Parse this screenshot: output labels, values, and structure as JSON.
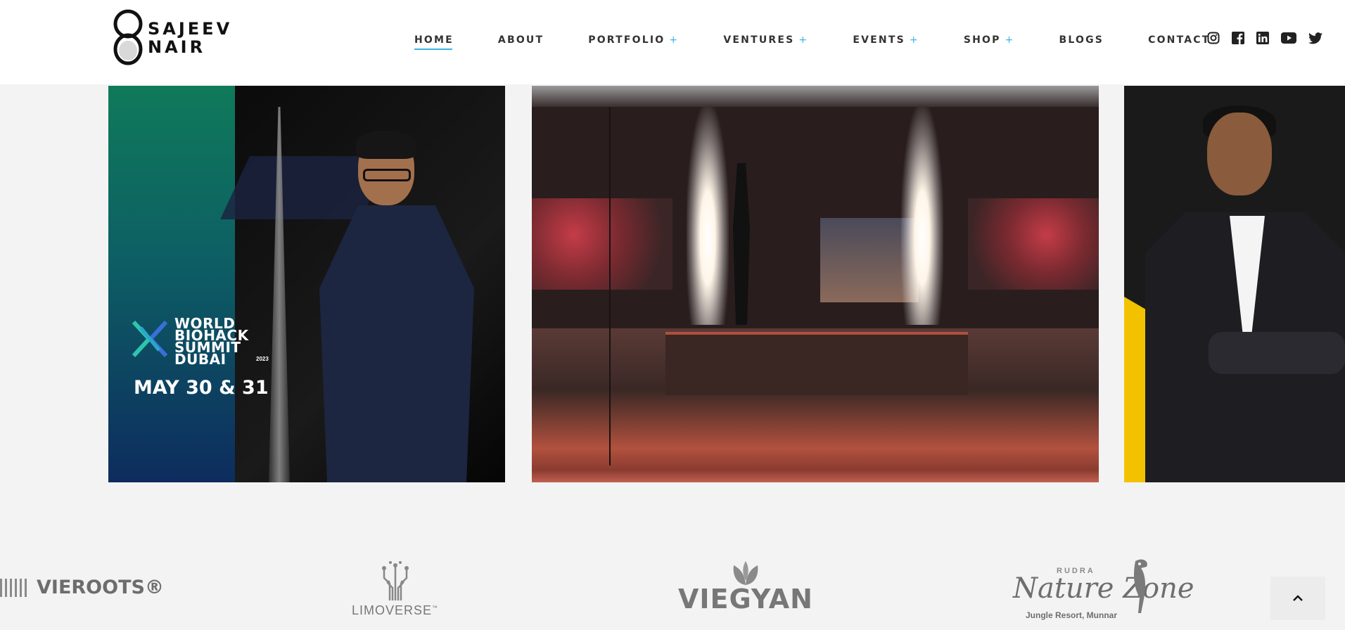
{
  "brand": {
    "name_line1": "SAJEEV",
    "name_line2": "NAIR"
  },
  "nav": {
    "items": [
      {
        "label": "HOME",
        "has_submenu": false,
        "active": true
      },
      {
        "label": "ABOUT",
        "has_submenu": false,
        "active": false
      },
      {
        "label": "PORTFOLIO",
        "has_submenu": true,
        "active": false
      },
      {
        "label": "VENTURES",
        "has_submenu": true,
        "active": false
      },
      {
        "label": "EVENTS",
        "has_submenu": true,
        "active": false
      },
      {
        "label": "SHOP",
        "has_submenu": true,
        "active": false
      },
      {
        "label": "BLOGS",
        "has_submenu": false,
        "active": false
      },
      {
        "label": "CONTACT",
        "has_submenu": false,
        "active": false
      }
    ],
    "submenu_marker": "+"
  },
  "social": [
    "instagram-icon",
    "facebook-icon",
    "linkedin-icon",
    "youtube-icon",
    "twitter-icon"
  ],
  "slides": {
    "summit": {
      "line1": "WORLD",
      "line2": "BIOHACK",
      "line3": "SUMMIT",
      "line4": "DUBAI",
      "year": "2023",
      "date": "MAY 30 & 31"
    }
  },
  "partners": {
    "vieroots": "VIEROOTS®",
    "limoverse": "LIMOVERSE",
    "limoverse_tm": "™",
    "viegyan": "VIEGYAN",
    "nature_brand": "RUDRA",
    "nature_name": "Nature Zone",
    "nature_tagline": "Jungle Resort, Munnar"
  },
  "colors": {
    "accent": "#3bb3e0",
    "summit_green": "#0f7a5a",
    "yellow": "#f2c200"
  },
  "scroll_top_icon": "chevron-up-icon"
}
